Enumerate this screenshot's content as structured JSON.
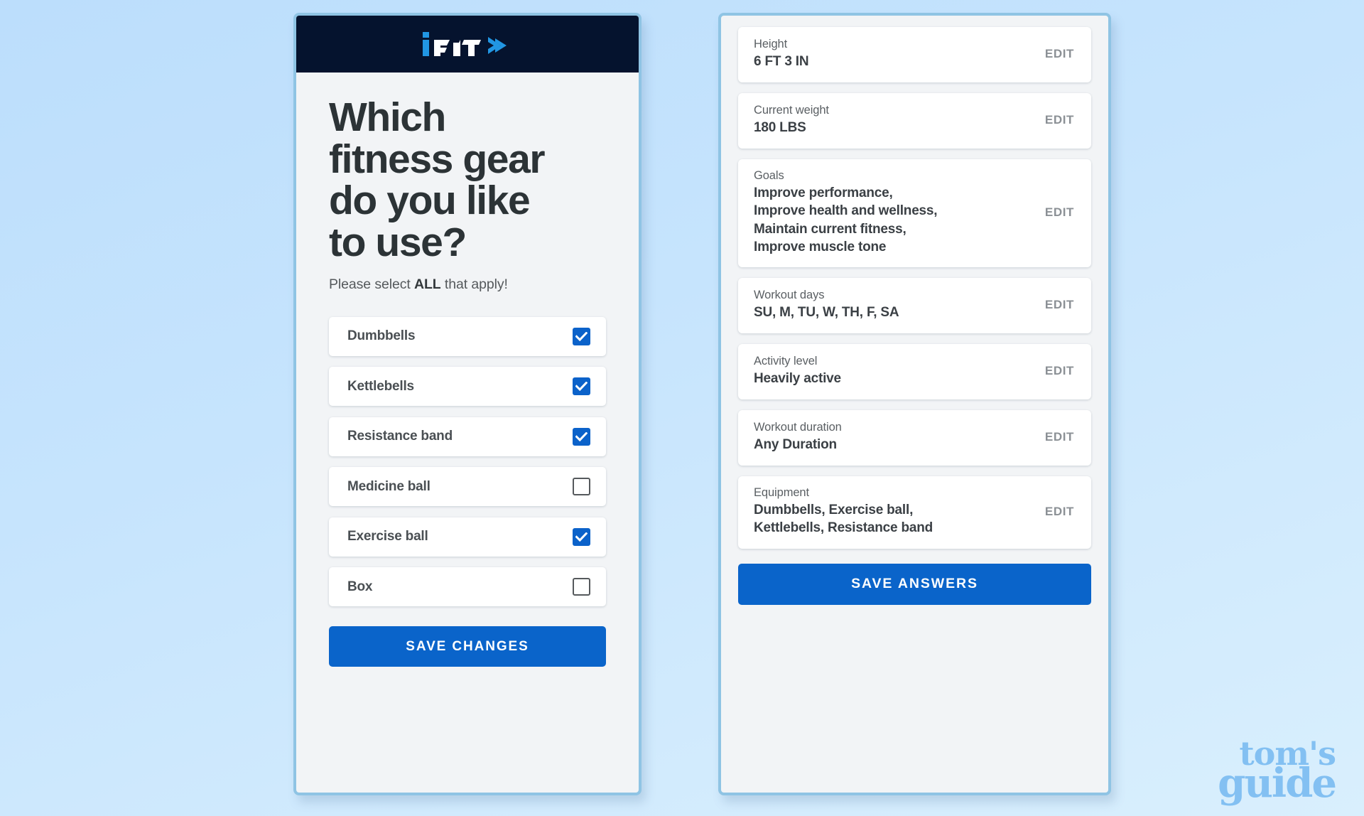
{
  "background": {
    "gradient_from": "#bcdefc",
    "gradient_to": "#d9effd"
  },
  "brand": {
    "logo_name": "iFIT",
    "logo_i_color": "#2196e3",
    "logo_text_color": "#ffffff",
    "logo_arrow_color": "#2196e3",
    "header_bg": "#05132e",
    "accent_blue": "#0a64ca"
  },
  "quiz": {
    "title": "Which fitness gear do you like to use?",
    "title_lines": [
      "Which",
      "fitness gear",
      "do you like",
      "to use?"
    ],
    "subtitle_prefix": "Please select ",
    "subtitle_emphasis": "ALL",
    "subtitle_suffix": " that apply!",
    "options": [
      {
        "label": "Dumbbells",
        "checked": true
      },
      {
        "label": "Kettlebells",
        "checked": true
      },
      {
        "label": "Resistance band",
        "checked": true
      },
      {
        "label": "Medicine ball",
        "checked": false
      },
      {
        "label": "Exercise ball",
        "checked": true
      },
      {
        "label": "Box",
        "checked": false
      }
    ],
    "save_label": "SAVE CHANGES"
  },
  "summary": {
    "edit_label": "EDIT",
    "cards": [
      {
        "label": "Height",
        "value_lines": [
          "6 FT 3 IN"
        ]
      },
      {
        "label": "Current weight",
        "value_lines": [
          "180 LBS"
        ]
      },
      {
        "label": "Goals",
        "value_lines": [
          "Improve performance,",
          "Improve health and wellness,",
          "Maintain current fitness,",
          "Improve muscle tone"
        ]
      },
      {
        "label": "Workout days",
        "value_lines": [
          "SU, M, TU, W, TH, F, SA"
        ]
      },
      {
        "label": "Activity level",
        "value_lines": [
          "Heavily active"
        ]
      },
      {
        "label": "Workout duration",
        "value_lines": [
          "Any Duration"
        ]
      },
      {
        "label": "Equipment",
        "value_lines": [
          "Dumbbells, Exercise ball,",
          "Kettlebells, Resistance band"
        ]
      }
    ],
    "save_label": "SAVE ANSWERS"
  },
  "watermark": {
    "line1": "tom's",
    "line2": "guide",
    "color": "#7cbdf2"
  }
}
